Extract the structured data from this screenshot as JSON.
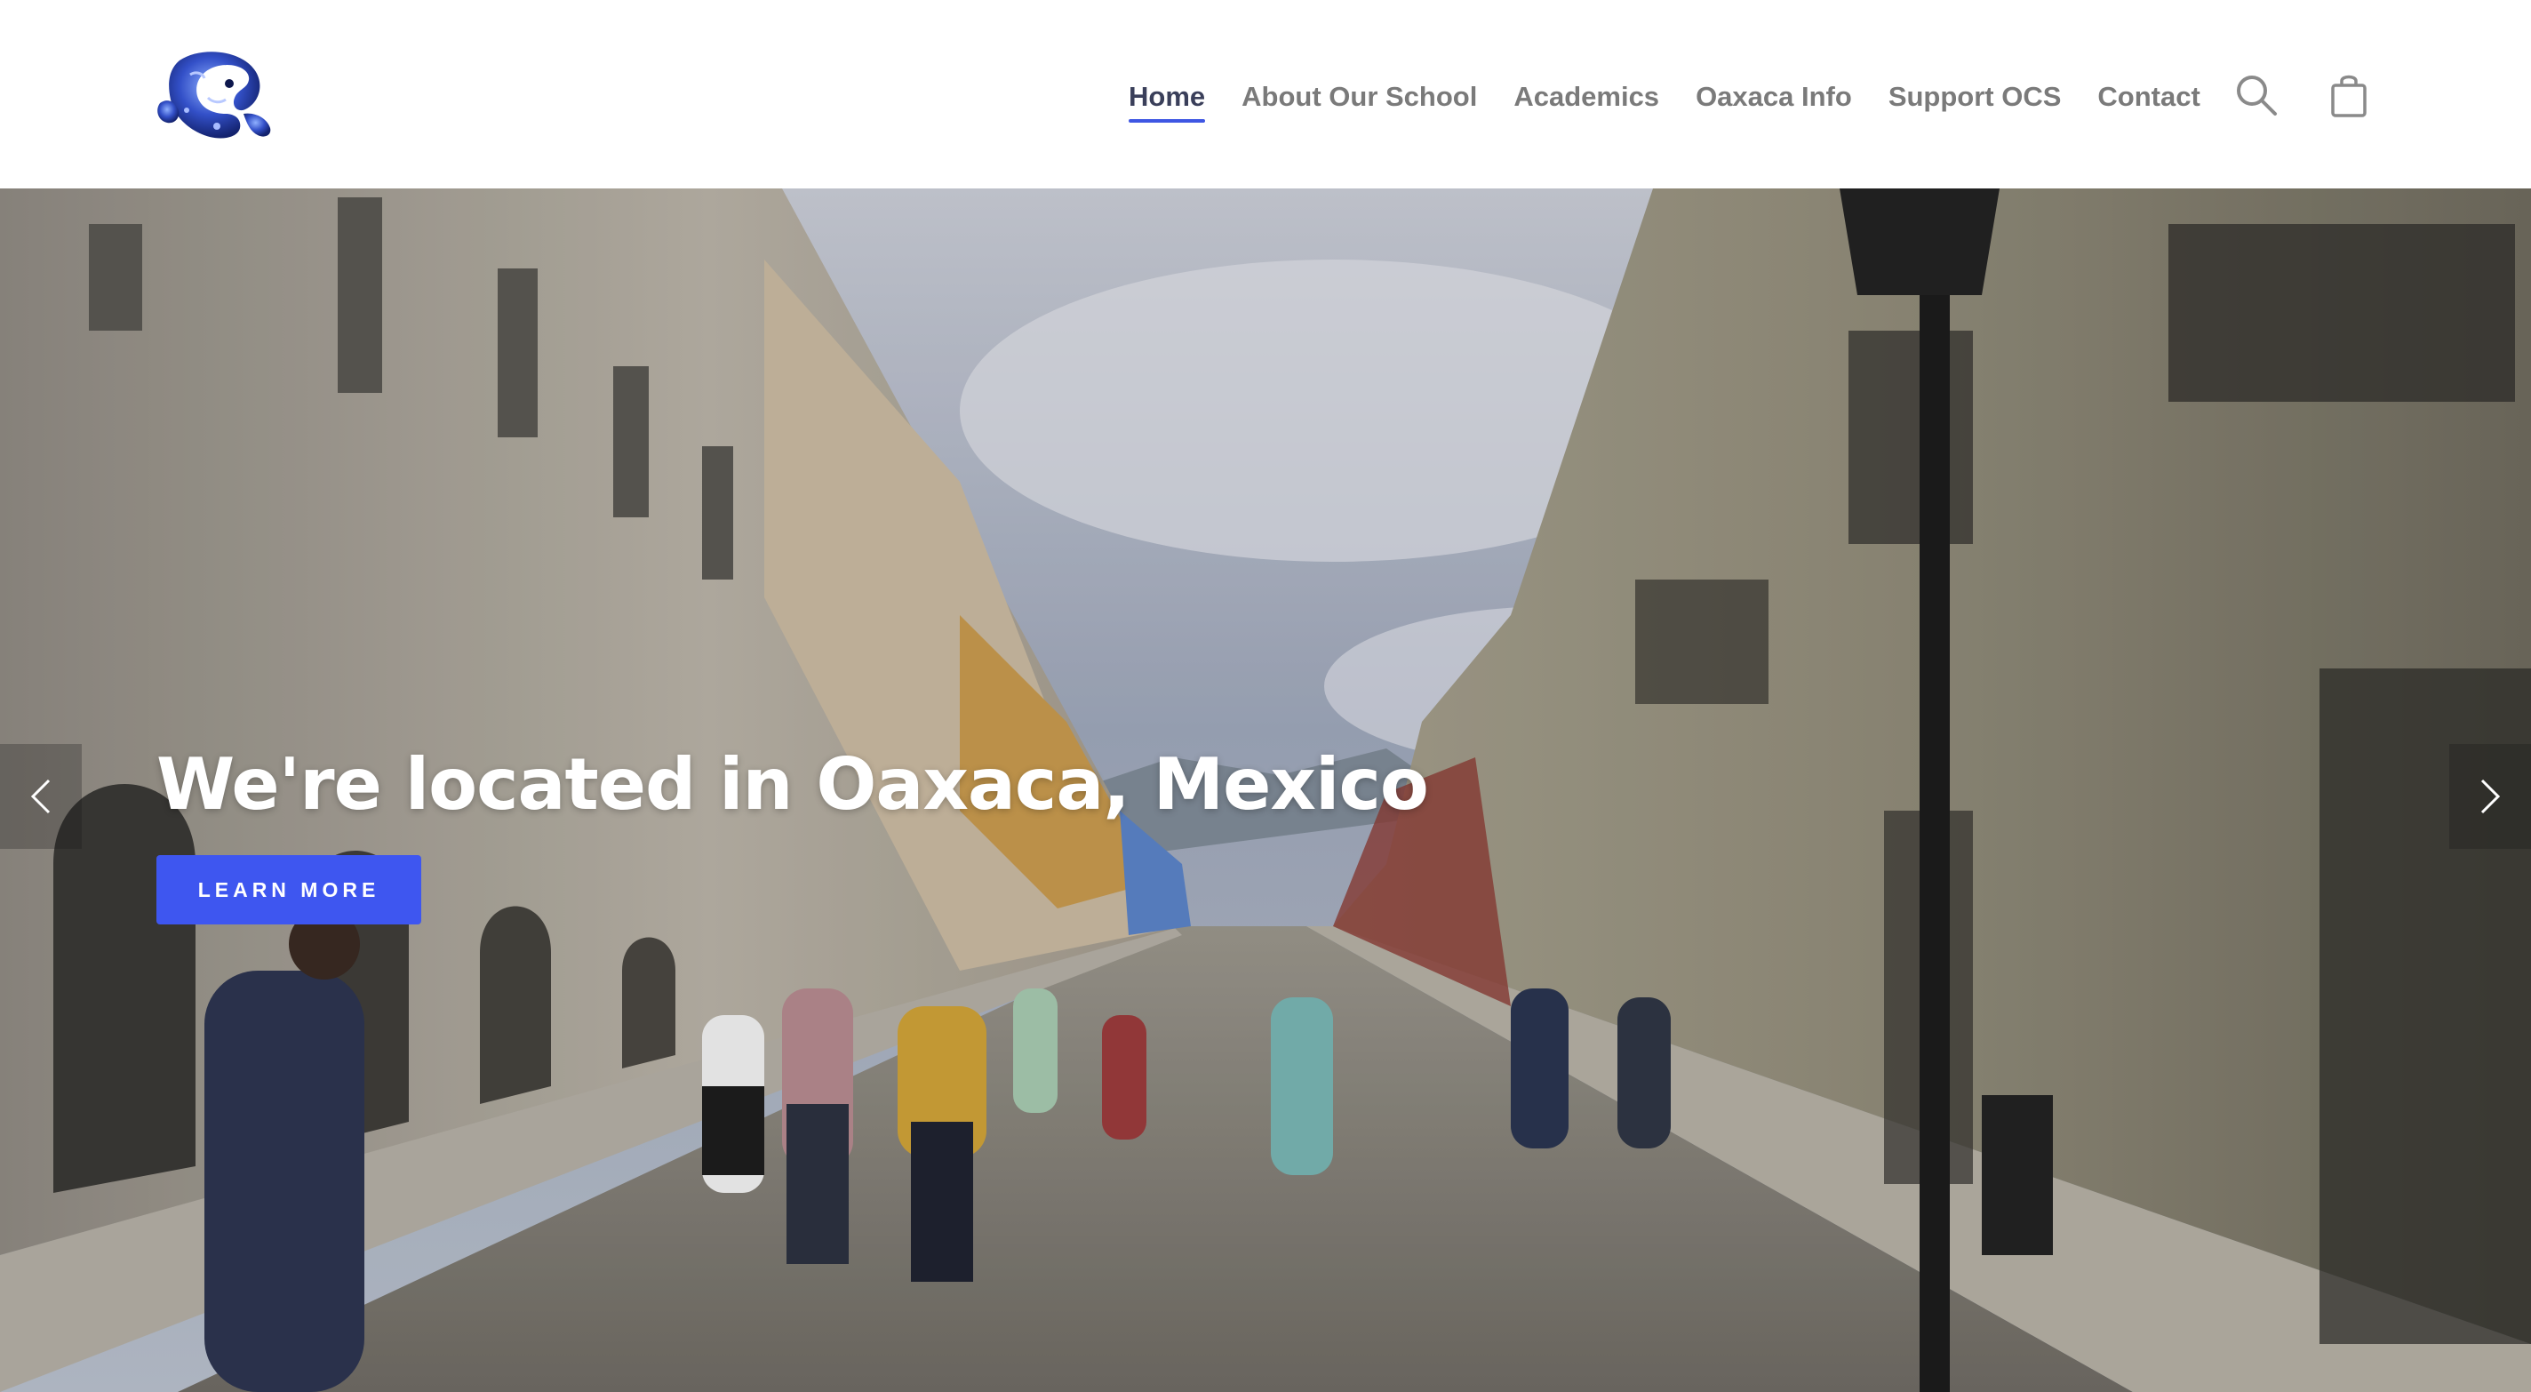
{
  "header": {
    "logo_icon": "lizard-logo-icon",
    "nav": [
      {
        "label": "Home",
        "active": true
      },
      {
        "label": "About Our School",
        "active": false
      },
      {
        "label": "Academics",
        "active": false
      },
      {
        "label": "Oaxaca Info",
        "active": false
      },
      {
        "label": "Support OCS",
        "active": false
      },
      {
        "label": "Contact",
        "active": false
      }
    ],
    "icons": {
      "search": "search-icon",
      "cart": "shopping-bag-icon"
    }
  },
  "hero": {
    "title": "We're located in Oaxaca, Mexico",
    "button_label": "LEARN MORE",
    "prev_icon": "chevron-left-icon",
    "next_icon": "chevron-right-icon"
  },
  "colors": {
    "accent": "#3e56f0",
    "nav_text": "#7a7a7a",
    "nav_active": "#3a3f5a",
    "hero_text": "#ffffff"
  }
}
